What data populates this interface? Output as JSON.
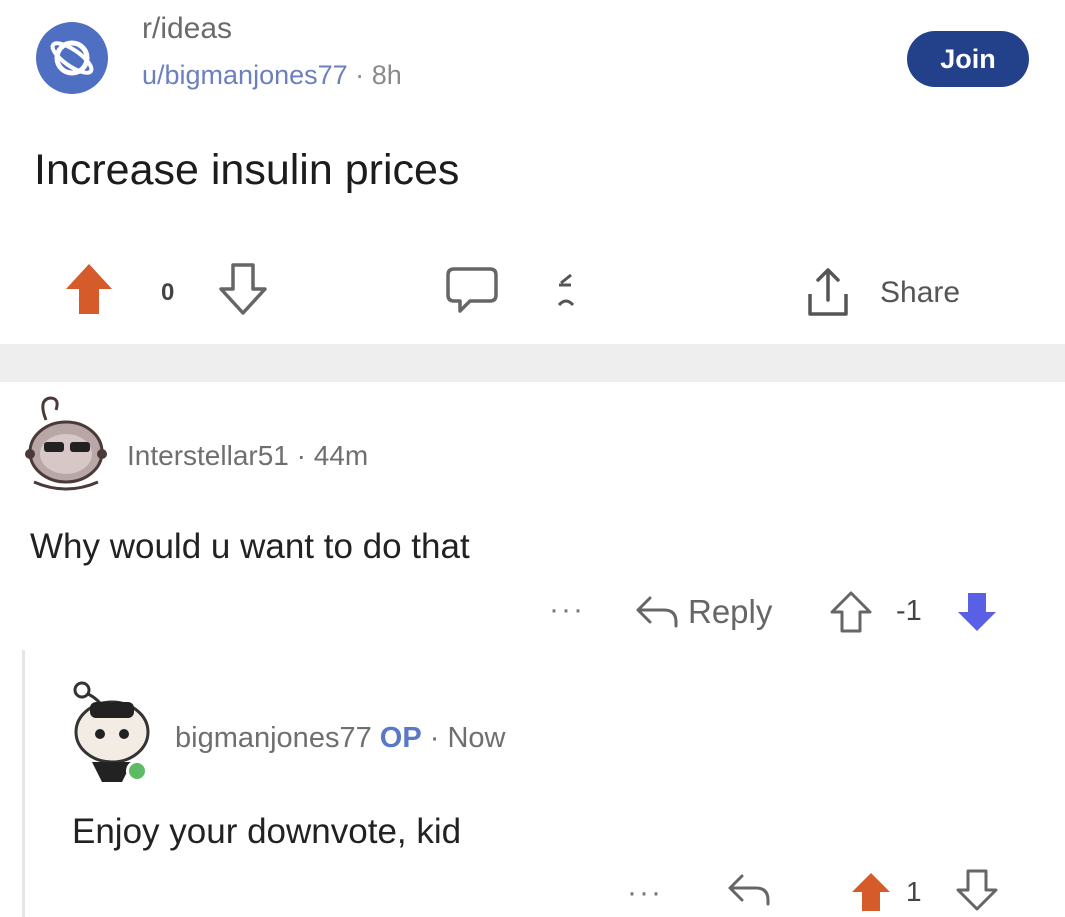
{
  "post": {
    "subreddit": "r/ideas",
    "author": "u/bigmanjones77",
    "separator": "·",
    "age": "8h",
    "join_label": "Join",
    "title": "Increase insulin prices",
    "score": "0",
    "share_label": "Share"
  },
  "comments": [
    {
      "author": "Interstellar51",
      "separator": "·",
      "age": "44m",
      "body": "Why would u want to do that",
      "more": "···",
      "reply_label": "Reply",
      "score": "-1"
    },
    {
      "author": "bigmanjones77",
      "op_badge": "OP",
      "separator": "·",
      "age": "Now",
      "body": "Enjoy your downvote, kid",
      "more": "···",
      "score": "1"
    }
  ],
  "colors": {
    "upvote": "#d65b2a",
    "downvote": "#5a60e6",
    "join_button": "#22418a",
    "subreddit_avatar": "#4f6fc2"
  },
  "icons": [
    "planet-icon",
    "upvote-icon",
    "downvote-icon",
    "comment-icon",
    "award-icon",
    "share-icon",
    "reply-icon",
    "more-icon"
  ]
}
